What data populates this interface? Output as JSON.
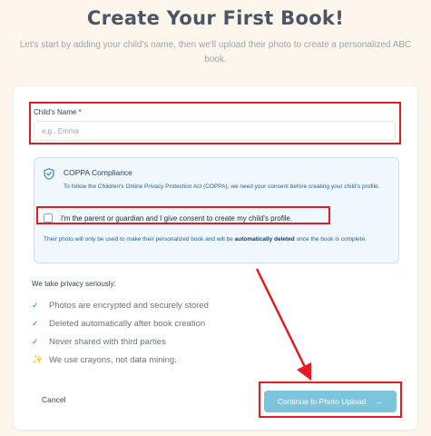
{
  "page": {
    "title": "Create Your First Book!",
    "subtitle": "Let's start by adding your child's name, then we'll upload their photo to create a personalized ABC book."
  },
  "form": {
    "name_label": "Child's Name *",
    "name_value": "",
    "name_placeholder": "e.g., Emma"
  },
  "coppa": {
    "title": "COPPA Compliance",
    "description": "To follow the Children's Online Privacy Protection Act (COPPA), we need your consent before creating your child's profile.",
    "consent_label": "I'm the parent or guardian and I give consent to create my child's profile.",
    "consent_checked": false,
    "note_prefix": "Their photo will only be used to make their personalized book and will be ",
    "note_bold": "automatically deleted",
    "note_suffix": " once the book is complete."
  },
  "privacy": {
    "title": "We take privacy seriously:",
    "items": [
      {
        "icon": "check-icon",
        "glyph": "✓",
        "text": "Photos are encrypted and securely stored"
      },
      {
        "icon": "check-icon",
        "glyph": "✓",
        "text": "Deleted automatically after book creation"
      },
      {
        "icon": "check-icon",
        "glyph": "✓",
        "text": "Never shared with third parties"
      },
      {
        "icon": "sparkles-icon",
        "glyph": "✨",
        "text": "We use crayons, not data mining."
      }
    ]
  },
  "actions": {
    "cancel_label": "Cancel",
    "continue_label": "Continue to Photo Upload",
    "continue_icon": "arrow-right-icon",
    "continue_glyph": "→"
  },
  "colors": {
    "background": "#fdf6ec",
    "accent": "#7cc3dc",
    "annotation": "#e31b23",
    "coppa_bg": "#f0f8fe",
    "check": "#16a34a"
  }
}
